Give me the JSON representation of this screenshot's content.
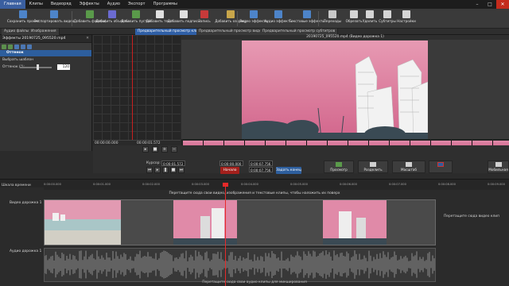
{
  "menu": {
    "items": [
      "Главная",
      "Клипы",
      "Видеоряд",
      "Эффекты",
      "Аудио",
      "Экспорт",
      "Программы"
    ],
    "active_index": 0
  },
  "toolbar": {
    "buttons": [
      {
        "label": "Сохранить проект",
        "icon": "floppy-icon",
        "color": "#4d84c9"
      },
      {
        "label": "Экспортировать видео",
        "icon": "export-icon",
        "color": "#4d84c9"
      },
      {
        "label": "Добавить файл(ы)",
        "icon": "add-file-icon",
        "color": "#5a9a4a"
      },
      {
        "label": "Добавить объекты",
        "icon": "add-objects-icon",
        "color": "#6b6bd1"
      },
      {
        "label": "Добавить пустой",
        "icon": "add-blank-icon",
        "color": "#5a9a4a"
      },
      {
        "label": "Добавить текст",
        "icon": "text-icon",
        "color": "#e0e0e0"
      },
      {
        "label": "Добавить подпись",
        "icon": "caption-icon",
        "color": "#e0e0e0"
      },
      {
        "label": "Запись",
        "icon": "record-icon",
        "color": "#c63a3a"
      },
      {
        "label": "Добавить озвучку",
        "icon": "voiceover-icon",
        "color": "#c8a64a"
      },
      {
        "label": "Видео эффекты",
        "icon": "video-fx-icon",
        "color": "#4d84c9"
      },
      {
        "label": "Аудио эффекты",
        "icon": "audio-fx-icon",
        "color": "#4d84c9"
      },
      {
        "label": "Текстовые эффекты",
        "icon": "text-fx-icon",
        "color": "#4d84c9"
      },
      {
        "label": "Переходы",
        "icon": "transitions-icon",
        "color": "#c9c9c9"
      },
      {
        "label": "Обрезать",
        "icon": "crop-icon",
        "color": "#d5d5d5"
      },
      {
        "label": "Удалить",
        "icon": "delete-icon",
        "color": "#d5d5d5"
      },
      {
        "label": "Субтитры",
        "icon": "subtitles-icon",
        "color": "#d5d5d5"
      },
      {
        "label": "Настройки",
        "icon": "settings-icon",
        "color": "#d5d5d5"
      }
    ]
  },
  "tabs": [
    "Аудио файлы",
    "Изображения",
    "Эффекты 20190725_095520.mp4"
  ],
  "preview_tabs": [
    "Предварительный просмотр клипа",
    "Предварительный просмотр видеоряда",
    "Предварительный просмотр субтитров"
  ],
  "effects_panel": {
    "header": "Эффекты 20190725_095520.mp4",
    "section": "Оттенок",
    "preset_label": "Выбрать шаблон",
    "param_label": "Оттенок (°):",
    "param_value": "120"
  },
  "preview": {
    "title": "20190725_095520.mp4 (Видео дорожка 1)"
  },
  "transport": {
    "cursor_label": "Курсор:",
    "cursor_value": "0:00:01.572",
    "start_value": "0:00:00.000",
    "end_value": "0:00:07.756",
    "duration_value": "0:00:07.756",
    "start_button": "Начало",
    "end_button": "Задать конец",
    "time_left": "00:00:00.000",
    "time_right": "00:00:01.572",
    "buttons": [
      {
        "label": "Просмотр",
        "icon": "play-preview-icon"
      },
      {
        "label": "Разделить",
        "icon": "split-icon"
      },
      {
        "label": "Масштаб",
        "icon": "zoom-icon"
      },
      {
        "label": "Мобильная",
        "icon": "mobile-icon"
      }
    ]
  },
  "timeline": {
    "track_label_left": "Шкала времени",
    "ruler_ticks": [
      "0:00:00.000",
      "0:00:01.000",
      "0:00:02.000",
      "0:00:03.000",
      "0:00:04.000",
      "0:00:05.000",
      "0:00:06.000",
      "0:00:07.000",
      "0:00:08.000",
      "0:00:09.000"
    ],
    "drop_hint": "Перетащите сюда свои видео, изображения и текстовые клипы, чтобы наложить их поверх",
    "video_track_label": "Видео дорожка 1",
    "audio_track_label": "Аудио дорожка 1",
    "side_hint": "Перетащите сюда видео клип",
    "bottom_hint": "Перетащите сюда свои аудио клипы для микширования"
  },
  "colors": {
    "accent": "#2d5e9d",
    "playhead": "#e62a2a",
    "tint": "#d97a98"
  }
}
